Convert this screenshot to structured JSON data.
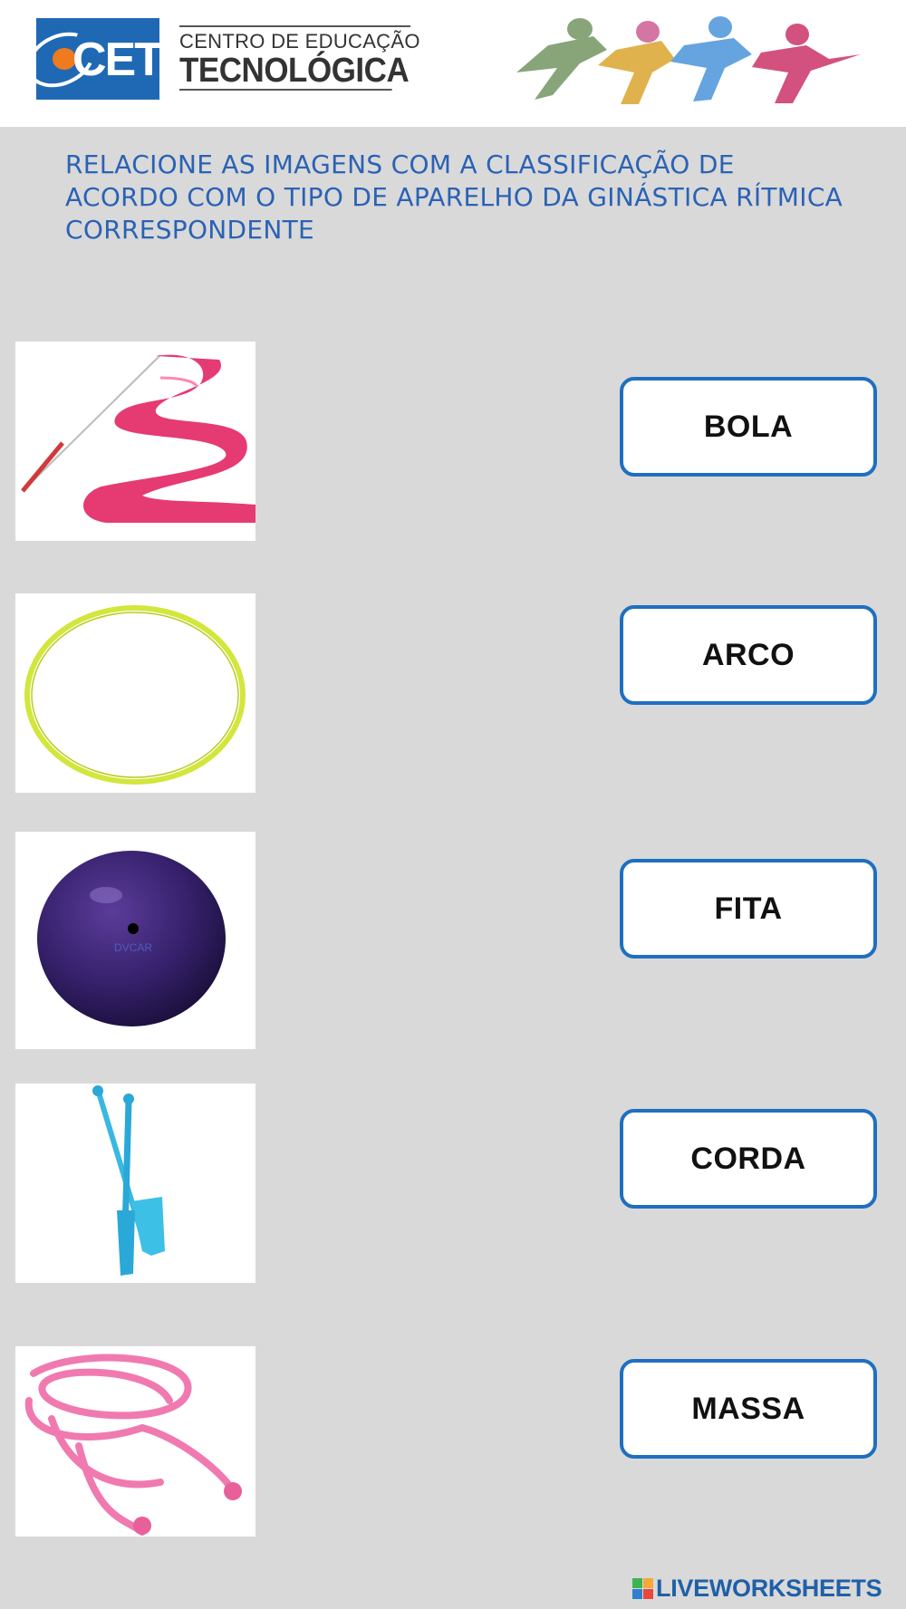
{
  "header": {
    "logo_text": "CET",
    "org_line1": "CENTRO DE EDUCAÇÃO",
    "org_line2": "TECNOLÓGICA"
  },
  "instructions": "RELACIONE AS IMAGENS COM A CLASSIFICAÇÃO DE ACORDO COM O TIPO DE APARELHO DA GINÁSTICA RÍTMICA CORRESPONDENTE",
  "items": [
    {
      "image": "ribbon-image"
    },
    {
      "image": "hoop-image"
    },
    {
      "image": "ball-image",
      "brand": "DVCAR"
    },
    {
      "image": "clubs-image"
    },
    {
      "image": "rope-image"
    }
  ],
  "answers": [
    {
      "label": "BOLA"
    },
    {
      "label": "ARCO"
    },
    {
      "label": "FITA"
    },
    {
      "label": "CORDA"
    },
    {
      "label": "MASSA"
    }
  ],
  "footer": {
    "brand": "LIVEWORKSHEETS"
  },
  "colors": {
    "brand_blue": "#1f69b4",
    "instruction_text": "#2a62b5",
    "box_border": "#1f6fc0",
    "page_bg": "#d9d9d9"
  }
}
